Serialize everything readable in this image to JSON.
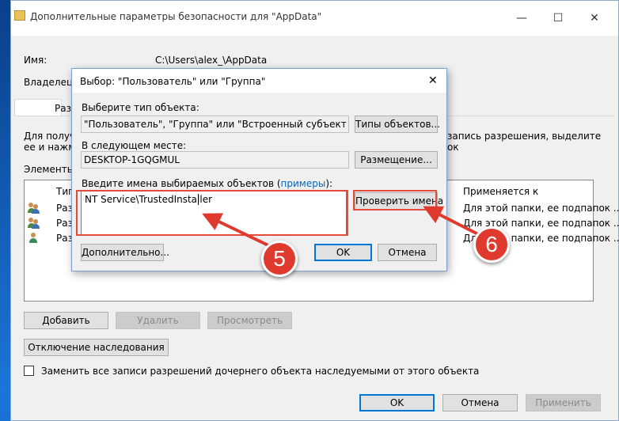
{
  "window": {
    "title": "Дополнительные параметры безопасности  для \"AppData\"",
    "minimize": "—",
    "maximize": "☐",
    "close": "✕"
  },
  "info": {
    "name_label": "Имя:",
    "name_value": "C:\\Users\\alex_\\AppData",
    "owner_label": "Владелец:"
  },
  "tab_label": "Разр",
  "description": {
    "line1_left": "Для получе",
    "line1_right": "запись разрешения, выделите",
    "line2_left": "ее и нажми",
    "line2_right": "ок"
  },
  "permissions": {
    "heading": "Элементы р",
    "col_type": "Тип",
    "col_applies": "Применяется к",
    "rows": [
      {
        "type": "Разр",
        "applies": "Для этой папки, ее подпапок ..."
      },
      {
        "type": "Разр",
        "applies": "Для этой папки, ее подпапок ..."
      },
      {
        "type": "Разр",
        "applies": "Для этой папки, ее подпапок ..."
      }
    ]
  },
  "buttons": {
    "add": "Добавить",
    "remove": "Удалить",
    "view": "Просмотреть",
    "disable_inheritance": "Отключение наследования",
    "ok": "OK",
    "cancel": "Отмена",
    "apply": "Применить"
  },
  "replace_checkbox": "Заменить все записи разрешений дочернего объекта наследуемыми от этого объекта",
  "dialog": {
    "title": "Выбор: \"Пользователь\" или \"Группа\"",
    "close": "✕",
    "object_type_label": "Выберите тип объекта:",
    "object_type_value": "\"Пользователь\", \"Группа\" или \"Встроенный субъект безопасности\"",
    "object_types_button": "Типы объектов...",
    "location_label": "В следующем месте:",
    "location_value": "DESKTOP-1GQGMUL",
    "location_button": "Размещение...",
    "names_label_before": "Введите имена выбираемых объектов (",
    "names_label_link": "примеры",
    "names_label_after": "):",
    "names_value": "NT Service\\TrustedInstaller",
    "check_names_button": "Проверить имена",
    "advanced_button": "Дополнительно...",
    "ok_button": "OK",
    "cancel_button": "Отмена"
  },
  "annotations": {
    "step5": "5",
    "step6": "6",
    "color": "#e03a2e"
  }
}
